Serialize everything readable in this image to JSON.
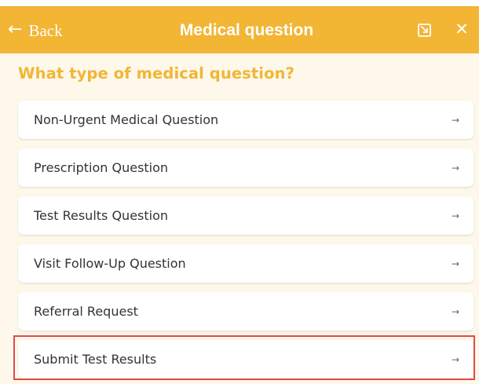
{
  "header": {
    "back_label": "Back",
    "back_icon": "left-arrow-icon",
    "title": "Medical question",
    "expand_icon": "expand-window-icon",
    "close_icon": "close-icon",
    "background_color": "#f2b534"
  },
  "main": {
    "heading": "What type of medical question?",
    "heading_color": "#f2b534",
    "options": [
      {
        "label": "Non-Urgent Medical Question",
        "icon": "right-arrow-icon"
      },
      {
        "label": "Prescription Question",
        "icon": "right-arrow-icon"
      },
      {
        "label": "Test Results Question",
        "icon": "right-arrow-icon"
      },
      {
        "label": "Visit Follow-Up Question",
        "icon": "right-arrow-icon"
      },
      {
        "label": "Referral Request",
        "icon": "right-arrow-icon"
      },
      {
        "label": "Submit Test Results",
        "icon": "right-arrow-icon",
        "highlighted": true
      }
    ]
  },
  "highlight": {
    "color": "#e04a4a"
  }
}
